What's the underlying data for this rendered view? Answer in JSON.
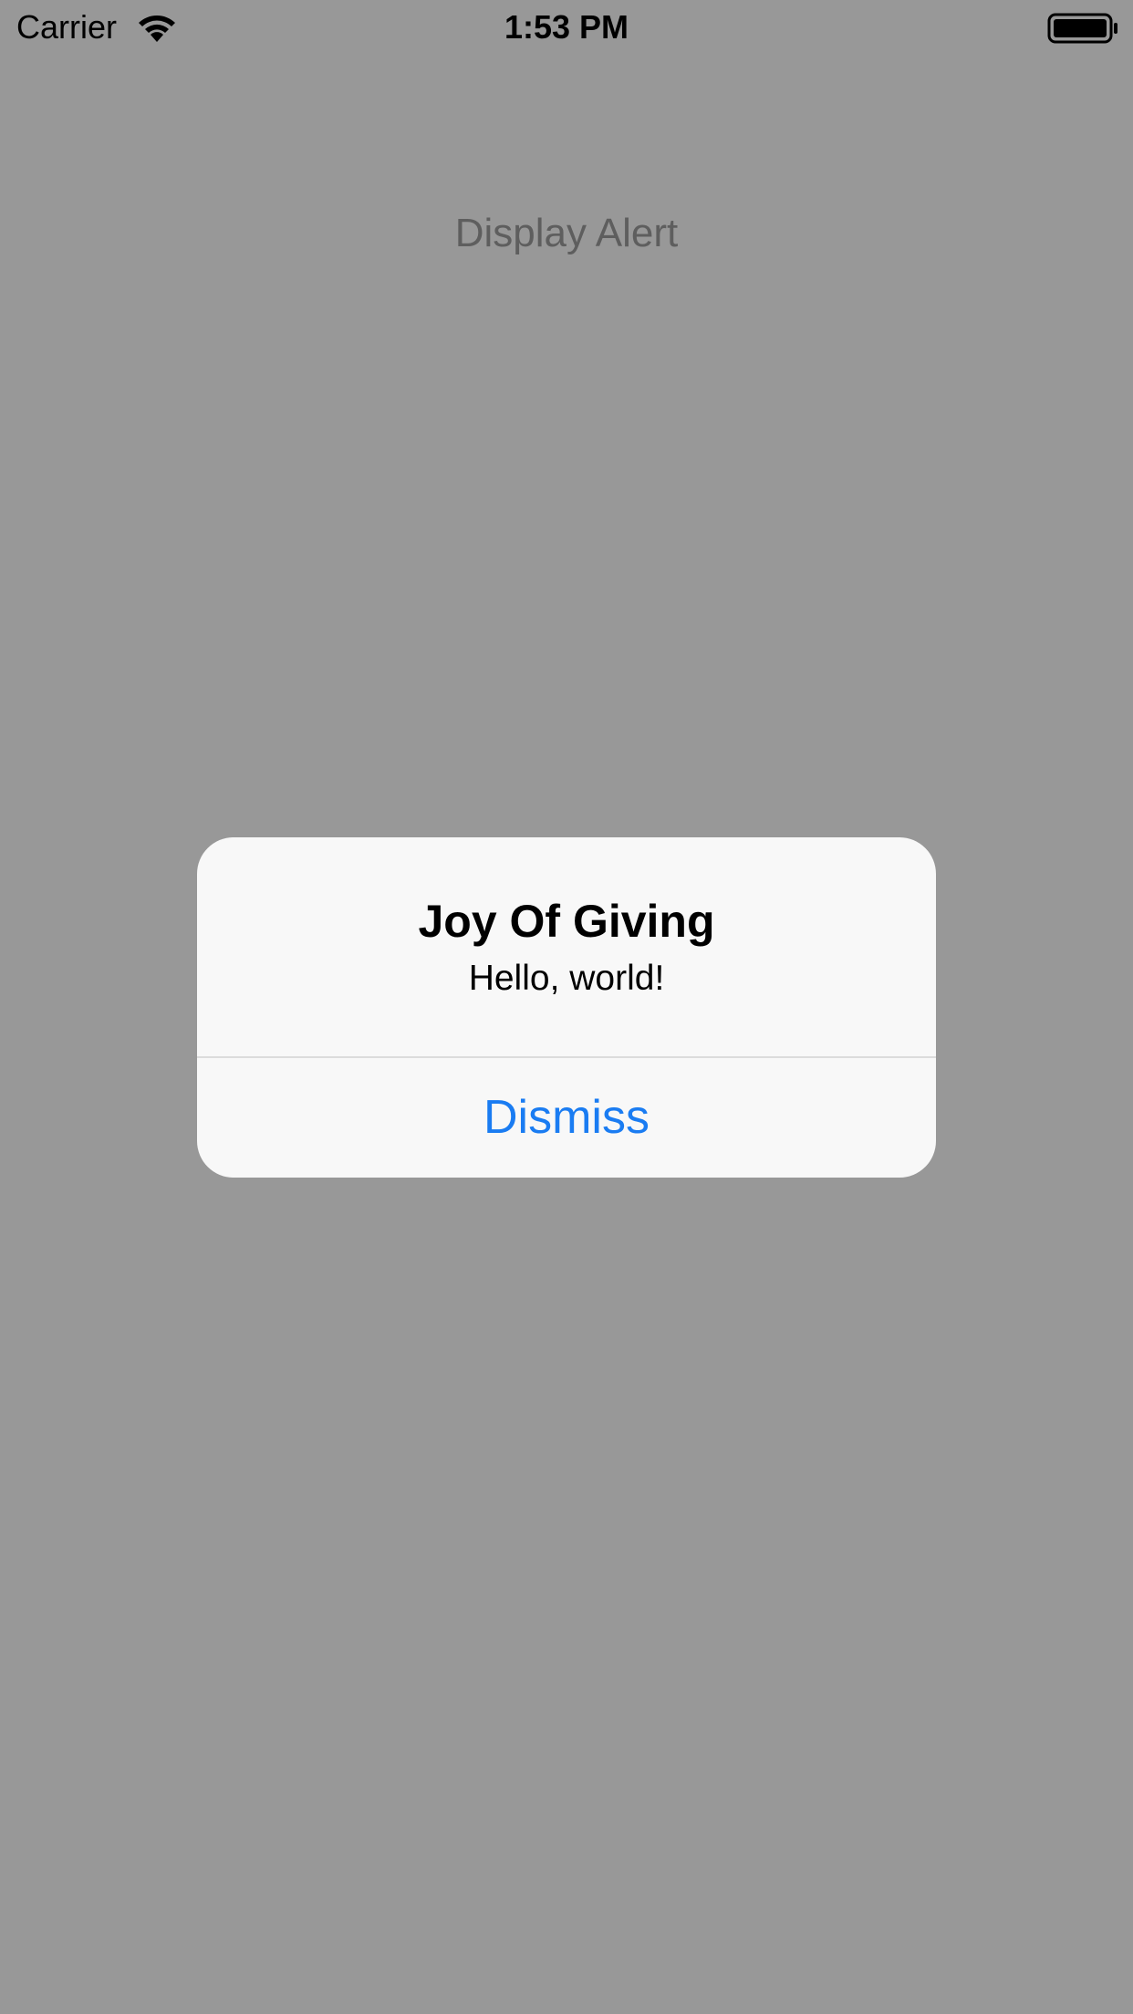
{
  "status_bar": {
    "carrier": "Carrier",
    "time": "1:53 PM",
    "wifi_icon": "wifi-icon",
    "battery_icon": "battery-icon"
  },
  "main": {
    "display_alert_label": "Display Alert"
  },
  "alert": {
    "title": "Joy Of Giving",
    "message": "Hello, world!",
    "dismiss_label": "Dismiss"
  },
  "colors": {
    "dimmed_background": "#989898",
    "alert_background": "#f8f8f8",
    "action_blue": "#1a7cf2"
  }
}
